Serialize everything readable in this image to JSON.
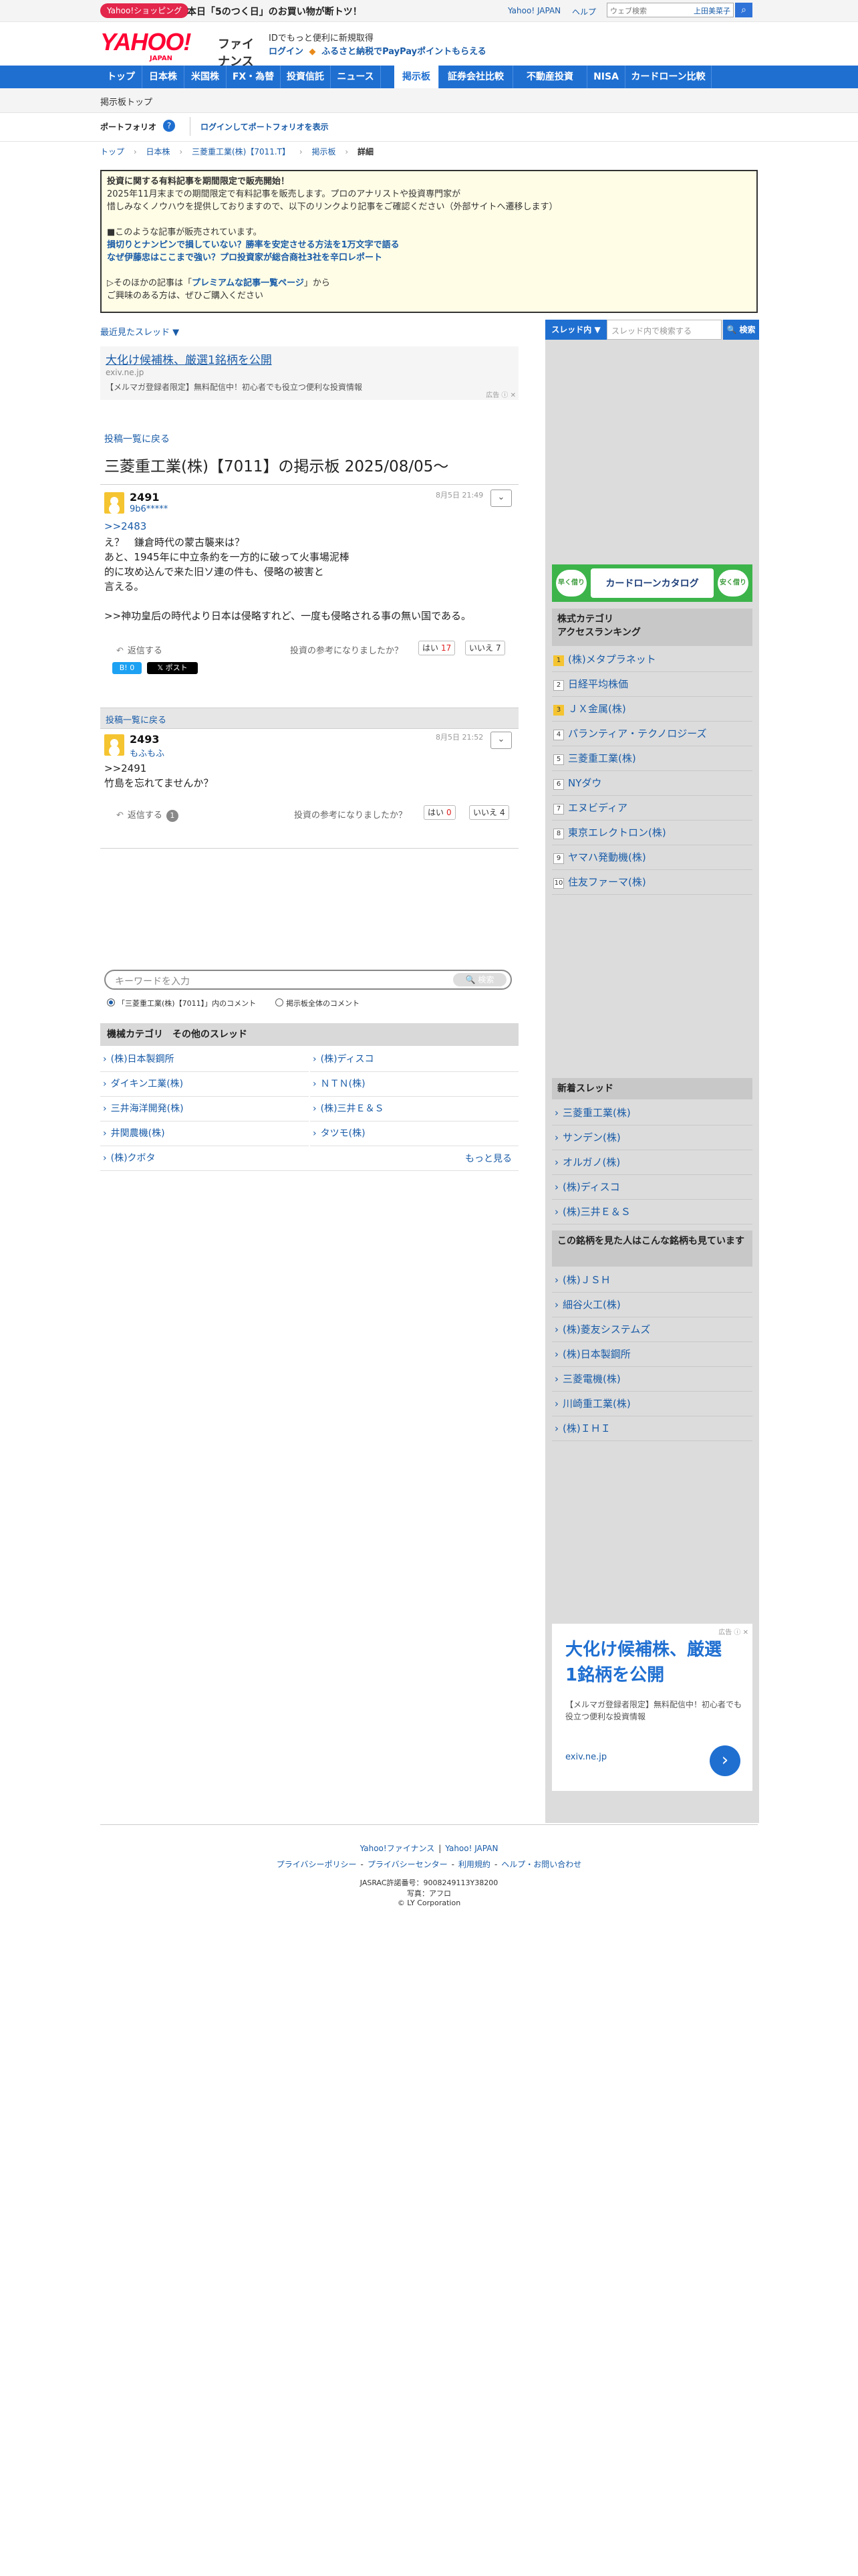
{
  "topbar": {
    "shopping_pill": "Yahoo!ショッピング",
    "shopping_text": "本日「5のつく日」のお買い物が断トツ！",
    "link_japan": "Yahoo! JAPAN",
    "link_help": "ヘルプ",
    "search_placeholder": "ウェブ検索",
    "ime_label": "上田美菜子"
  },
  "header": {
    "logo_main": "YAHOO!",
    "logo_sub": "JAPAN",
    "logo_service": "ファイナンス",
    "promo_line1": "IDでもっと便利に新規取得",
    "promo_login": "ログイン",
    "promo_line2": "ふるさと納税でPayPayポイントもらえる"
  },
  "nav": {
    "items": [
      "トップ",
      "日本株",
      "米国株",
      "FX・為替",
      "投資信託",
      "ニュース",
      "掲示板",
      "証券会社比較",
      "不動産投資",
      "NISA",
      "カードローン比較"
    ]
  },
  "subbar": {
    "label": "掲示板トップ"
  },
  "portfolio": {
    "label": "ポートフォリオ",
    "help": "?",
    "link": "ログインしてポートフォリオを表示"
  },
  "breadcrumb": [
    "トップ",
    "日本株",
    "三菱重工業(株)【7011.T】",
    "掲示板",
    "詳細"
  ],
  "notice": {
    "title": "投資に関する有料記事を期間限定で販売開始！",
    "line1": "2025年11月末までの期間限定で有料記事を販売します。プロのアナリストや投資専門家が",
    "line2": "惜しみなくノウハウを提供しておりますので、以下のリンクより記事をご確認ください（外部サイトへ遷移します）",
    "line3": "■このような記事が販売されています。",
    "link1": "損切りとナンピンで損していない？勝率を安定させる方法を1万文字で語る",
    "link2": "なぜ伊藤忠はここまで強い？プロ投資家が総合商社3社を辛口レポート",
    "line4a": "▷そのほかの記事は「",
    "line4link": "プレミアムな記事一覧ページ",
    "line4b": "」から",
    "line5": "ご興味のある方は、ぜひご購入ください"
  },
  "main": {
    "recent_label": "最近見たスレッド ▼",
    "ad": {
      "headline": "大化け候補株、厳選1銘柄を公開",
      "url": "exiv.ne.jp",
      "desc": "【メルマガ登録者限定】無料配信中！初心者でも役立つ便利な投資情報",
      "marker": "広告 ⓘ ✕"
    },
    "back_label": "投稿一覧に戻る",
    "board_title": "三菱重工業(株)【7011】の掲示板 2025/08/05〜",
    "posts": [
      {
        "number": "2491",
        "user": "9b6*****",
        "date": "8月5日 21:49",
        "reply_ref": ">>2483",
        "body": "え？　鎌倉時代の蒙古襲来は？\nあと、1945年に中立条約を一方的に破って火事場泥棒\n的に攻め込んで来た旧ソ連の件も、侵略の被害と\n言える。\n\n>>神功皇后の時代より日本は侵略すれど、一度も侵略される事の無い国である。",
        "reply_label": "返信する",
        "vote_question": "投資の参考になりましたか？",
        "yes_label": "はい",
        "yes_count": "17",
        "no_label": "いいえ",
        "no_count": "7",
        "sns_share_label": "B! 0",
        "sns_post_label": "𝕏 ポスト"
      },
      {
        "number": "2493",
        "user": "もふもふ",
        "date": "8月5日 21:52",
        "body": ">>2491\n竹島を忘れてませんか？",
        "reply_label": "返信する",
        "reply_count": "1",
        "vote_question": "投資の参考になりましたか？",
        "yes_label": "はい",
        "yes_count": "0",
        "no_label": "いいえ",
        "no_count": "4"
      }
    ],
    "keyword_placeholder": "キーワードを入力",
    "keyword_button": "検索",
    "radio_thread": "「三菱重工業(株)【7011】」内のコメント",
    "radio_all": "掲示板全体のコメント",
    "category_header": "機械カテゴリ　その他のスレッド",
    "category_items": [
      "(株)日本製鋼所",
      "(株)ディスコ",
      "ダイキン工業(株)",
      "ＮＴＮ(株)",
      "三井海洋開発(株)",
      "(株)三井Ｅ＆Ｓ",
      "井関農機(株)",
      "タツモ(株)",
      "(株)クボタ"
    ],
    "more_label": "もっと見る"
  },
  "sidebar": {
    "scope_button": "スレッド内 ▼",
    "search_placeholder": "スレッド内で検索する",
    "search_button": "🔍 検索",
    "banner_text": "カードローンカタログ",
    "banner_left": "早く借りたい",
    "banner_right": "安く借りたい",
    "ranking_title": "株式カテゴリ\nアクセスランキング",
    "ranking": [
      "(株)メタプラネット",
      "日経平均株価",
      "ＪＸ金属(株)",
      "パランティア・テクノロジーズ",
      "三菱重工業(株)",
      "NYダウ",
      "エヌビディア",
      "東京エレクトロン(株)",
      "ヤマハ発動機(株)",
      "住友ファーマ(株)"
    ],
    "new_threads_title": "新着スレッド",
    "new_threads": [
      "三菱重工業(株)",
      "サンデン(株)",
      "オルガノ(株)",
      "(株)ディスコ",
      "(株)三井Ｅ＆Ｓ"
    ],
    "also_viewed_title": "この銘柄を見た人はこんな銘柄も見ています",
    "also_viewed": [
      "(株)ＪＳＨ",
      "細谷火工(株)",
      "(株)菱友システムズ",
      "(株)日本製鋼所",
      "三菱電機(株)",
      "川崎重工業(株)",
      "(株)ＩＨＩ"
    ],
    "ad": {
      "marker": "広告 ⓘ ✕",
      "headline": "大化け候補株、厳選1銘柄を公開",
      "desc": "【メルマガ登録者限定】無料配信中！初心者でも役立つ便利な投資情報",
      "url": "exiv.ne.jp",
      "go": "›"
    }
  },
  "footer": {
    "row1": [
      "Yahoo!ファイナンス",
      "Yahoo! JAPAN"
    ],
    "row2": [
      "プライバシーポリシー",
      "プライバシーセンター",
      "利用規約",
      "ヘルプ・お問い合わせ"
    ],
    "jasrac": "JASRAC許諾番号：9008249113Y38200",
    "photo": "写真：アフロ",
    "copyright": "© LY Corporation"
  }
}
